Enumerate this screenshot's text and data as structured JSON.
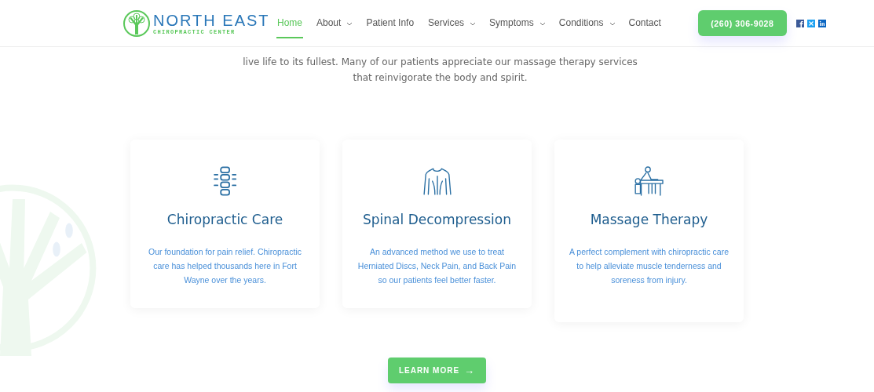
{
  "header": {
    "logo": {
      "title": "NORTH EAST",
      "subtitle": "CHIROPRACTIC CENTER"
    },
    "nav": [
      {
        "label": "Home",
        "selected": true,
        "dropdown": false
      },
      {
        "label": "About",
        "selected": false,
        "dropdown": true
      },
      {
        "label": "Patient Info",
        "selected": false,
        "dropdown": false
      },
      {
        "label": "Services",
        "selected": false,
        "dropdown": true
      },
      {
        "label": "Symptoms",
        "selected": false,
        "dropdown": true
      },
      {
        "label": "Conditions",
        "selected": false,
        "dropdown": true
      },
      {
        "label": "Contact",
        "selected": false,
        "dropdown": false
      }
    ],
    "phone_button": "(260) 306-9028",
    "social": [
      {
        "kind": "facebook"
      },
      {
        "kind": "x"
      },
      {
        "kind": "linkedin"
      }
    ]
  },
  "intro": [
    "live life to its fullest. Many of our patients appreciate our massage therapy services",
    "that reinvigorate the body and spirit."
  ],
  "services": [
    {
      "kind": "spine",
      "title": "Chiropractic Care",
      "text": "Our foundation for pain relief. Chiropractic care has helped thousands here in Fort Wayne over the years."
    },
    {
      "kind": "back",
      "title": "Spinal Decompression",
      "text": "An advanced method we use to treat Herniated Discs, Neck Pain, and Back Pain so our patients feel better faster."
    },
    {
      "kind": "massage",
      "title": "Massage Therapy",
      "text": "A perfect complement with chiropractic care to help alleviate muscle tenderness and soreness from injury."
    }
  ],
  "cta": {
    "label": "LEARN MORE",
    "arrow": "→"
  }
}
